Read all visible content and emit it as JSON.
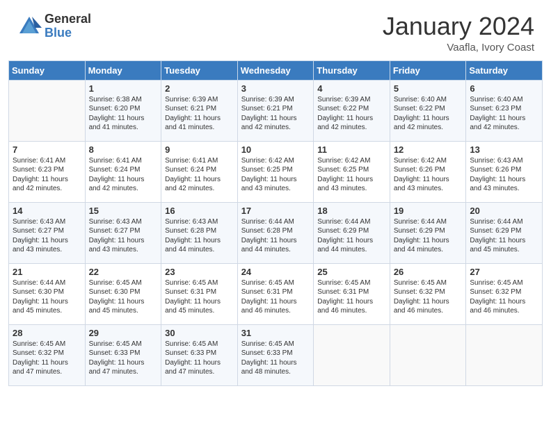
{
  "header": {
    "logo_general": "General",
    "logo_blue": "Blue",
    "month_title": "January 2024",
    "subtitle": "Vaafla, Ivory Coast"
  },
  "days_of_week": [
    "Sunday",
    "Monday",
    "Tuesday",
    "Wednesday",
    "Thursday",
    "Friday",
    "Saturday"
  ],
  "weeks": [
    [
      {
        "day": "",
        "sunrise": "",
        "sunset": "",
        "daylight": ""
      },
      {
        "day": "1",
        "sunrise": "Sunrise: 6:38 AM",
        "sunset": "Sunset: 6:20 PM",
        "daylight": "Daylight: 11 hours and 41 minutes."
      },
      {
        "day": "2",
        "sunrise": "Sunrise: 6:39 AM",
        "sunset": "Sunset: 6:21 PM",
        "daylight": "Daylight: 11 hours and 41 minutes."
      },
      {
        "day": "3",
        "sunrise": "Sunrise: 6:39 AM",
        "sunset": "Sunset: 6:21 PM",
        "daylight": "Daylight: 11 hours and 42 minutes."
      },
      {
        "day": "4",
        "sunrise": "Sunrise: 6:39 AM",
        "sunset": "Sunset: 6:22 PM",
        "daylight": "Daylight: 11 hours and 42 minutes."
      },
      {
        "day": "5",
        "sunrise": "Sunrise: 6:40 AM",
        "sunset": "Sunset: 6:22 PM",
        "daylight": "Daylight: 11 hours and 42 minutes."
      },
      {
        "day": "6",
        "sunrise": "Sunrise: 6:40 AM",
        "sunset": "Sunset: 6:23 PM",
        "daylight": "Daylight: 11 hours and 42 minutes."
      }
    ],
    [
      {
        "day": "7",
        "sunrise": "Sunrise: 6:41 AM",
        "sunset": "Sunset: 6:23 PM",
        "daylight": "Daylight: 11 hours and 42 minutes."
      },
      {
        "day": "8",
        "sunrise": "Sunrise: 6:41 AM",
        "sunset": "Sunset: 6:24 PM",
        "daylight": "Daylight: 11 hours and 42 minutes."
      },
      {
        "day": "9",
        "sunrise": "Sunrise: 6:41 AM",
        "sunset": "Sunset: 6:24 PM",
        "daylight": "Daylight: 11 hours and 42 minutes."
      },
      {
        "day": "10",
        "sunrise": "Sunrise: 6:42 AM",
        "sunset": "Sunset: 6:25 PM",
        "daylight": "Daylight: 11 hours and 43 minutes."
      },
      {
        "day": "11",
        "sunrise": "Sunrise: 6:42 AM",
        "sunset": "Sunset: 6:25 PM",
        "daylight": "Daylight: 11 hours and 43 minutes."
      },
      {
        "day": "12",
        "sunrise": "Sunrise: 6:42 AM",
        "sunset": "Sunset: 6:26 PM",
        "daylight": "Daylight: 11 hours and 43 minutes."
      },
      {
        "day": "13",
        "sunrise": "Sunrise: 6:43 AM",
        "sunset": "Sunset: 6:26 PM",
        "daylight": "Daylight: 11 hours and 43 minutes."
      }
    ],
    [
      {
        "day": "14",
        "sunrise": "Sunrise: 6:43 AM",
        "sunset": "Sunset: 6:27 PM",
        "daylight": "Daylight: 11 hours and 43 minutes."
      },
      {
        "day": "15",
        "sunrise": "Sunrise: 6:43 AM",
        "sunset": "Sunset: 6:27 PM",
        "daylight": "Daylight: 11 hours and 43 minutes."
      },
      {
        "day": "16",
        "sunrise": "Sunrise: 6:43 AM",
        "sunset": "Sunset: 6:28 PM",
        "daylight": "Daylight: 11 hours and 44 minutes."
      },
      {
        "day": "17",
        "sunrise": "Sunrise: 6:44 AM",
        "sunset": "Sunset: 6:28 PM",
        "daylight": "Daylight: 11 hours and 44 minutes."
      },
      {
        "day": "18",
        "sunrise": "Sunrise: 6:44 AM",
        "sunset": "Sunset: 6:29 PM",
        "daylight": "Daylight: 11 hours and 44 minutes."
      },
      {
        "day": "19",
        "sunrise": "Sunrise: 6:44 AM",
        "sunset": "Sunset: 6:29 PM",
        "daylight": "Daylight: 11 hours and 44 minutes."
      },
      {
        "day": "20",
        "sunrise": "Sunrise: 6:44 AM",
        "sunset": "Sunset: 6:29 PM",
        "daylight": "Daylight: 11 hours and 45 minutes."
      }
    ],
    [
      {
        "day": "21",
        "sunrise": "Sunrise: 6:44 AM",
        "sunset": "Sunset: 6:30 PM",
        "daylight": "Daylight: 11 hours and 45 minutes."
      },
      {
        "day": "22",
        "sunrise": "Sunrise: 6:45 AM",
        "sunset": "Sunset: 6:30 PM",
        "daylight": "Daylight: 11 hours and 45 minutes."
      },
      {
        "day": "23",
        "sunrise": "Sunrise: 6:45 AM",
        "sunset": "Sunset: 6:31 PM",
        "daylight": "Daylight: 11 hours and 45 minutes."
      },
      {
        "day": "24",
        "sunrise": "Sunrise: 6:45 AM",
        "sunset": "Sunset: 6:31 PM",
        "daylight": "Daylight: 11 hours and 46 minutes."
      },
      {
        "day": "25",
        "sunrise": "Sunrise: 6:45 AM",
        "sunset": "Sunset: 6:31 PM",
        "daylight": "Daylight: 11 hours and 46 minutes."
      },
      {
        "day": "26",
        "sunrise": "Sunrise: 6:45 AM",
        "sunset": "Sunset: 6:32 PM",
        "daylight": "Daylight: 11 hours and 46 minutes."
      },
      {
        "day": "27",
        "sunrise": "Sunrise: 6:45 AM",
        "sunset": "Sunset: 6:32 PM",
        "daylight": "Daylight: 11 hours and 46 minutes."
      }
    ],
    [
      {
        "day": "28",
        "sunrise": "Sunrise: 6:45 AM",
        "sunset": "Sunset: 6:32 PM",
        "daylight": "Daylight: 11 hours and 47 minutes."
      },
      {
        "day": "29",
        "sunrise": "Sunrise: 6:45 AM",
        "sunset": "Sunset: 6:33 PM",
        "daylight": "Daylight: 11 hours and 47 minutes."
      },
      {
        "day": "30",
        "sunrise": "Sunrise: 6:45 AM",
        "sunset": "Sunset: 6:33 PM",
        "daylight": "Daylight: 11 hours and 47 minutes."
      },
      {
        "day": "31",
        "sunrise": "Sunrise: 6:45 AM",
        "sunset": "Sunset: 6:33 PM",
        "daylight": "Daylight: 11 hours and 48 minutes."
      },
      {
        "day": "",
        "sunrise": "",
        "sunset": "",
        "daylight": ""
      },
      {
        "day": "",
        "sunrise": "",
        "sunset": "",
        "daylight": ""
      },
      {
        "day": "",
        "sunrise": "",
        "sunset": "",
        "daylight": ""
      }
    ]
  ]
}
